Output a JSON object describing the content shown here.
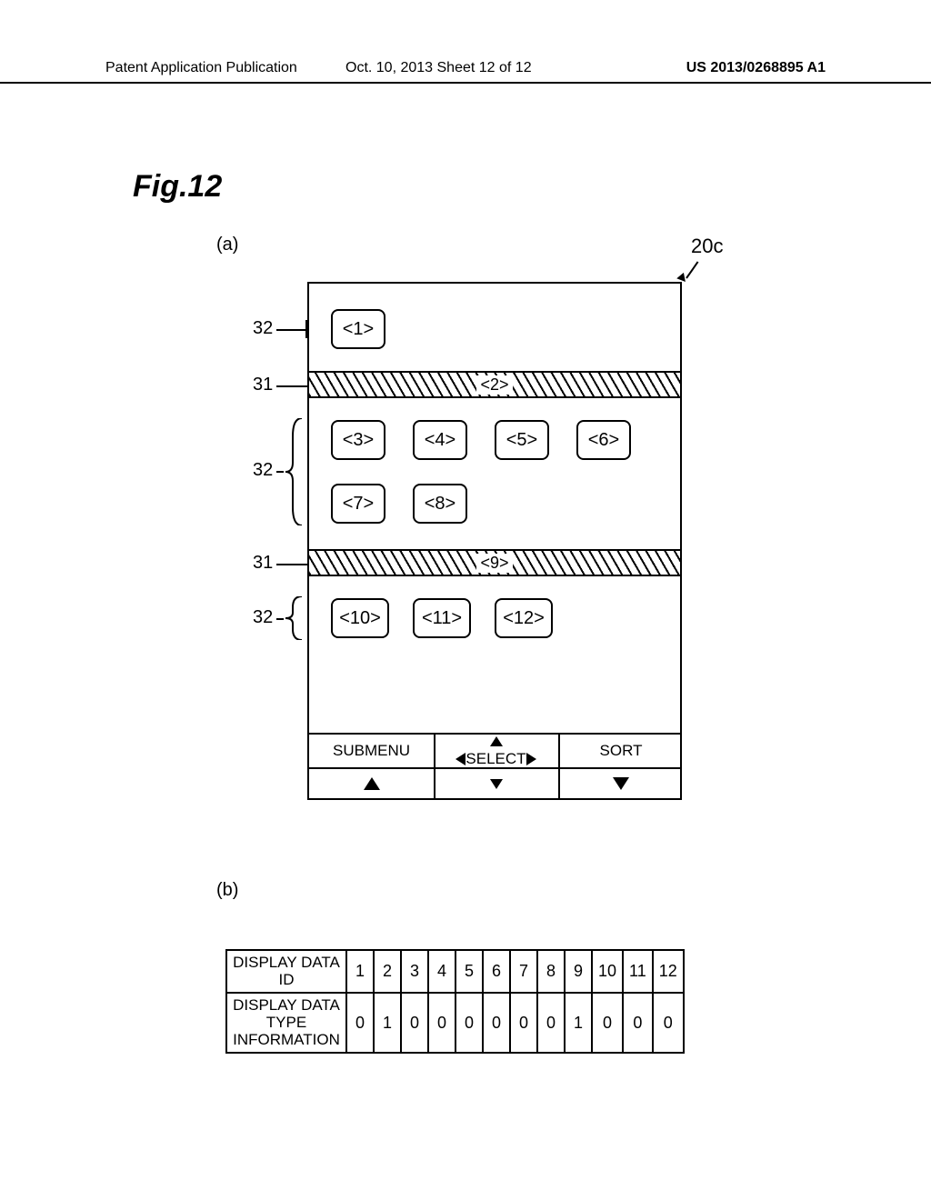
{
  "header": {
    "left": "Patent Application Publication",
    "mid": "Oct. 10, 2013  Sheet 12 of 12",
    "right": "US 2013/0268895 A1"
  },
  "figure_title": "Fig.12",
  "part_a_label": "(a)",
  "part_b_label": "(b)",
  "ref_20c": "20c",
  "refs": {
    "r32_a": "32",
    "r31_a": "31",
    "r32_b": "32",
    "r31_b": "31",
    "r32_c": "32"
  },
  "tiles": {
    "t1": "<1>",
    "t2": "<2>",
    "t3": "<3>",
    "t4": "<4>",
    "t5": "<5>",
    "t6": "<6>",
    "t7": "<7>",
    "t8": "<8>",
    "t9": "<9>",
    "t10": "<10>",
    "t11": "<11>",
    "t12": "<12>"
  },
  "softkeys": {
    "submenu": "SUBMENU",
    "select": " SELECT ",
    "sort": "SORT"
  },
  "table": {
    "row1_label": "DISPLAY DATA ID",
    "row2_label": "DISPLAY DATA TYPE INFORMATION",
    "ids": [
      "1",
      "2",
      "3",
      "4",
      "5",
      "6",
      "7",
      "8",
      "9",
      "10",
      "11",
      "12"
    ],
    "types": [
      "0",
      "1",
      "0",
      "0",
      "0",
      "0",
      "0",
      "0",
      "1",
      "0",
      "0",
      "0"
    ]
  }
}
